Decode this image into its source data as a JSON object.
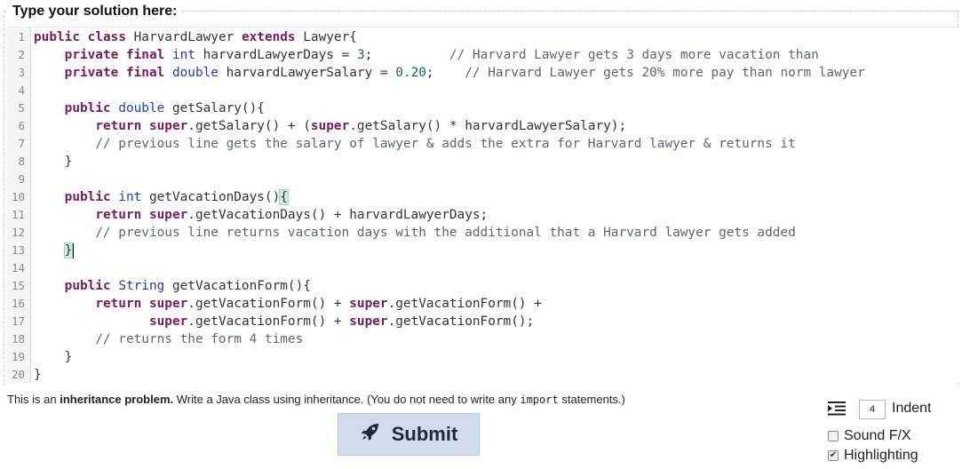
{
  "header": {
    "legend": "Type your solution here:"
  },
  "editor": {
    "line_numbers": [
      "1",
      "2",
      "3",
      "4",
      "5",
      "6",
      "7",
      "8",
      "9",
      "10",
      "11",
      "12",
      "13",
      "14",
      "15",
      "16",
      "17",
      "18",
      "19",
      "20"
    ],
    "lines": [
      {
        "indent": "",
        "tokens": [
          [
            "kw",
            "public"
          ],
          [
            "t",
            " "
          ],
          [
            "kw",
            "class"
          ],
          [
            "t",
            " HarvardLawyer "
          ],
          [
            "kw",
            "extends"
          ],
          [
            "t",
            " Lawyer{"
          ]
        ]
      },
      {
        "indent": "    ",
        "tokens": [
          [
            "kw",
            "private"
          ],
          [
            "t",
            " "
          ],
          [
            "kw",
            "final"
          ],
          [
            "t",
            " "
          ],
          [
            "ty",
            "int"
          ],
          [
            "t",
            " harvardLawyerDays = "
          ],
          [
            "num",
            "3"
          ],
          [
            "t",
            ";          "
          ],
          [
            "cm",
            "// Harvard Lawyer gets 3 days more vacation than"
          ]
        ]
      },
      {
        "indent": "    ",
        "tokens": [
          [
            "kw",
            "private"
          ],
          [
            "t",
            " "
          ],
          [
            "kw",
            "final"
          ],
          [
            "t",
            " "
          ],
          [
            "ty",
            "double"
          ],
          [
            "t",
            " harvardLawyerSalary = "
          ],
          [
            "num",
            "0.20"
          ],
          [
            "t",
            ";    "
          ],
          [
            "cm",
            "// Harvard Lawyer gets 20% more pay than norm lawyer"
          ]
        ]
      },
      {
        "indent": "",
        "tokens": []
      },
      {
        "indent": "    ",
        "tokens": [
          [
            "kw",
            "public"
          ],
          [
            "t",
            " "
          ],
          [
            "ty",
            "double"
          ],
          [
            "t",
            " getSalary(){"
          ]
        ]
      },
      {
        "indent": "        ",
        "tokens": [
          [
            "kw",
            "return"
          ],
          [
            "t",
            " "
          ],
          [
            "kw",
            "super"
          ],
          [
            "t",
            ".getSalary() + ("
          ],
          [
            "kw",
            "super"
          ],
          [
            "t",
            ".getSalary() * harvardLawyerSalary);"
          ]
        ]
      },
      {
        "indent": "        ",
        "tokens": [
          [
            "cm",
            "// previous line gets the salary of lawyer & adds the extra for Harvard lawyer & returns it"
          ]
        ]
      },
      {
        "indent": "    ",
        "tokens": [
          [
            "t",
            "}"
          ]
        ]
      },
      {
        "indent": "",
        "tokens": []
      },
      {
        "indent": "    ",
        "tokens": [
          [
            "kw",
            "public"
          ],
          [
            "t",
            " "
          ],
          [
            "ty",
            "int"
          ],
          [
            "t",
            " getVacationDays()"
          ],
          [
            "mh",
            "{"
          ]
        ]
      },
      {
        "indent": "        ",
        "tokens": [
          [
            "kw",
            "return"
          ],
          [
            "t",
            " "
          ],
          [
            "kw",
            "super"
          ],
          [
            "t",
            ".getVacationDays() + harvardLawyerDays;"
          ]
        ]
      },
      {
        "indent": "        ",
        "tokens": [
          [
            "cm",
            "// previous line returns vacation days with the additional that a Harvard lawyer gets added"
          ]
        ]
      },
      {
        "indent": "    ",
        "tokens": [
          [
            "mh",
            "}"
          ],
          [
            "cursor",
            ""
          ]
        ]
      },
      {
        "indent": "",
        "tokens": []
      },
      {
        "indent": "    ",
        "tokens": [
          [
            "kw",
            "public"
          ],
          [
            "t",
            " "
          ],
          [
            "ty",
            "String"
          ],
          [
            "t",
            " getVacationForm(){"
          ]
        ]
      },
      {
        "indent": "        ",
        "tokens": [
          [
            "kw",
            "return"
          ],
          [
            "t",
            " "
          ],
          [
            "kw",
            "super"
          ],
          [
            "t",
            ".getVacationForm() + "
          ],
          [
            "kw",
            "super"
          ],
          [
            "t",
            ".getVacationForm() +"
          ]
        ]
      },
      {
        "indent": "               ",
        "tokens": [
          [
            "kw",
            "super"
          ],
          [
            "t",
            ".getVacationForm() + "
          ],
          [
            "kw",
            "super"
          ],
          [
            "t",
            ".getVacationForm();"
          ]
        ]
      },
      {
        "indent": "        ",
        "tokens": [
          [
            "cm",
            "// returns the form 4 times"
          ]
        ]
      },
      {
        "indent": "    ",
        "tokens": [
          [
            "t",
            "}"
          ]
        ]
      },
      {
        "indent": "",
        "tokens": [
          [
            "t",
            "}"
          ]
        ]
      }
    ]
  },
  "instructions": {
    "part1": "This is an ",
    "bold": "inheritance problem.",
    "part2": " Write a Java class using inheritance. (You do not need to write any ",
    "code": "import",
    "part3": " statements.)"
  },
  "submit": {
    "label": "Submit",
    "icon": "rocket-icon"
  },
  "settings": {
    "indent_value": "4",
    "indent_label": "Indent",
    "sound_label": "Sound F/X",
    "sound_checked": false,
    "highlighting_label": "Highlighting",
    "highlighting_checked": true
  }
}
